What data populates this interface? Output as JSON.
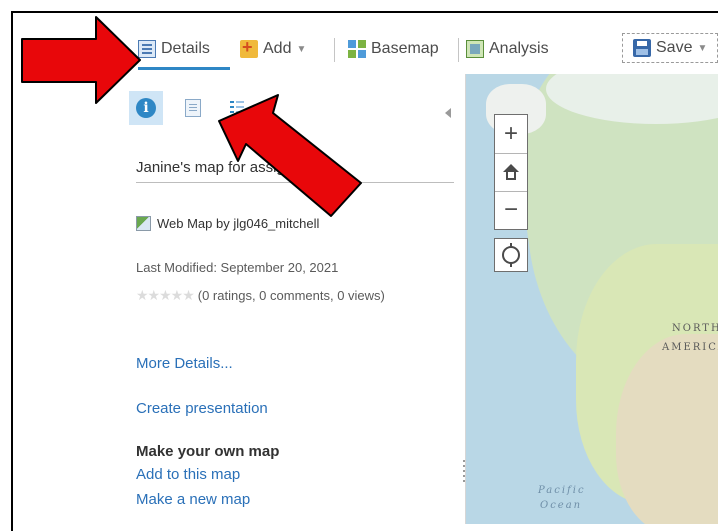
{
  "toolbar": {
    "details_label": "Details",
    "add_label": "Add",
    "basemap_label": "Basemap",
    "analysis_label": "Analysis",
    "save_label": "Save"
  },
  "panel": {
    "map_title": "Janine's map for assignment",
    "owner": "Web Map by jlg046_mitchell",
    "last_modified": "Last Modified: September 20, 2021",
    "ratings": "(0 ratings, 0 comments, 0 views)",
    "stars_glyph": "★★★★★",
    "more_details": "More Details...",
    "create_presentation": "Create presentation",
    "own_map_heading": "Make your own map",
    "add_to_map": "Add to this map",
    "make_new_map": "Make a new map"
  },
  "map": {
    "zoom_in": "+",
    "zoom_out": "−",
    "labels": {
      "north": "NORTH",
      "america": "AMERICA",
      "pacific": "Pacific",
      "ocean": "Ocean"
    }
  },
  "colors": {
    "accent": "#2e87c5",
    "link": "#2a70b8",
    "annotation_arrow": "#e8070a"
  }
}
